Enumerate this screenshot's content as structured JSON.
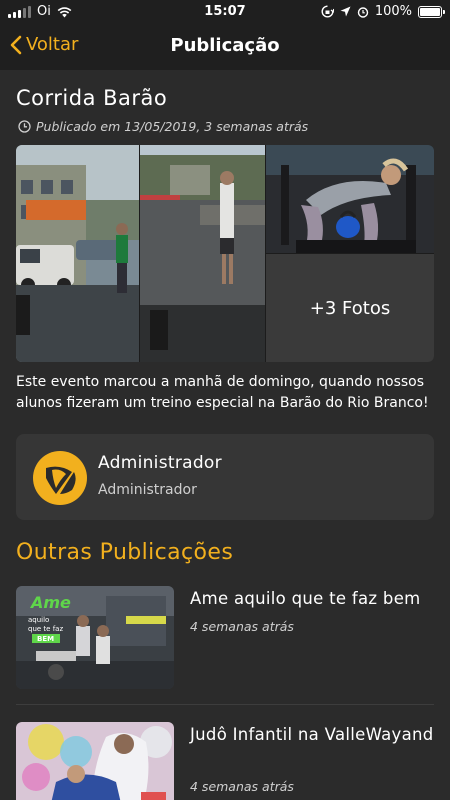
{
  "status_bar": {
    "carrier": "Oi",
    "time": "15:07",
    "battery": "100%",
    "battery_level": 1.0
  },
  "nav": {
    "back_label": "Voltar",
    "title": "Publicação"
  },
  "post": {
    "title": "Corrida Barão",
    "date": "Publicado em 13/05/2019, 3 semanas atrás",
    "more_photos": "+3 Fotos",
    "text": "Este evento marcou a manhã de domingo, quando nossos alunos fizeram um treino especial na Barão do Rio Branco!"
  },
  "author": {
    "name": "Administrador",
    "role": "Administrador"
  },
  "other": {
    "section_title": "Outras Publicações",
    "items": [
      {
        "title": "Ame aquilo que te faz bem",
        "date": "4 semanas atrás",
        "thumb_text": "Ame aquilo que te faz BEM"
      },
      {
        "title": "Judô Infantil na ValleWayand",
        "date": "4 semanas atrás"
      }
    ]
  },
  "colors": {
    "accent": "#f2b01e",
    "background": "#2b2b2b",
    "bar": "#1f1f1f",
    "card": "#363636"
  }
}
